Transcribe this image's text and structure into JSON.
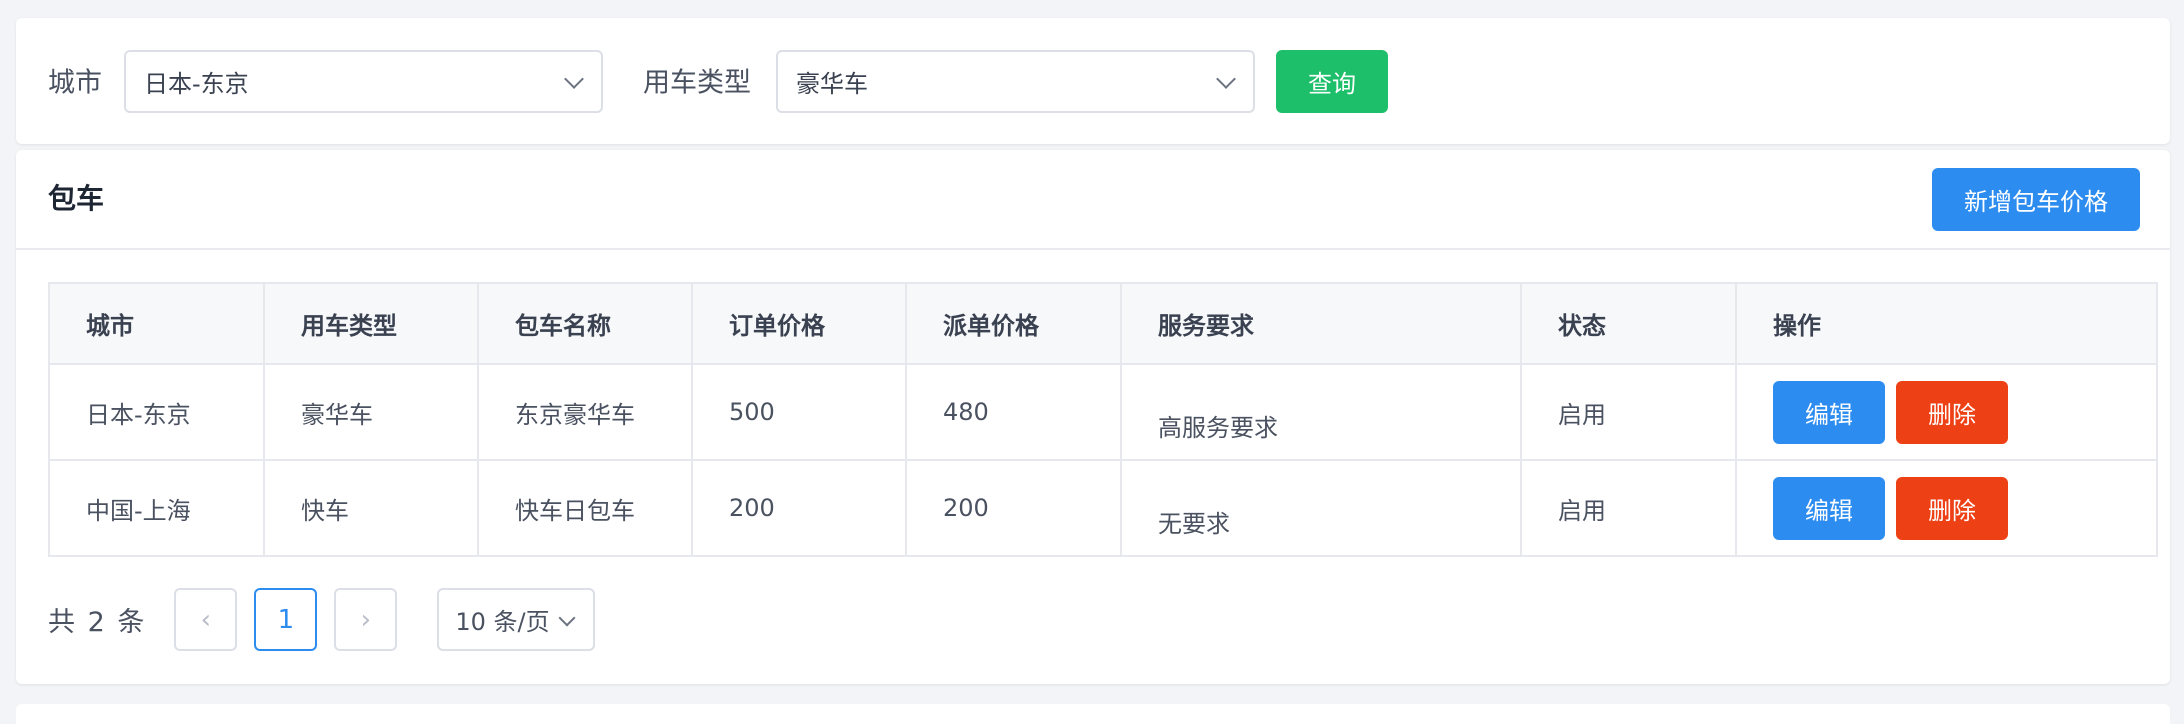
{
  "filter": {
    "city_label": "城市",
    "city_value": "日本-东京",
    "car_type_label": "用车类型",
    "car_type_value": "豪华车",
    "query_button": "查询"
  },
  "section": {
    "title": "包车",
    "add_button": "新增包车价格"
  },
  "table": {
    "columns": [
      "城市",
      "用车类型",
      "包车名称",
      "订单价格",
      "派单价格",
      "服务要求",
      "状态",
      "操作"
    ],
    "rows": [
      {
        "city": "日本-东京",
        "car_type": "豪华车",
        "name": "东京豪华车",
        "order_price": "500",
        "dispatch_price": "480",
        "service": "高服务要求",
        "status": "启用"
      },
      {
        "city": "中国-上海",
        "car_type": "快车",
        "name": "快车日包车",
        "order_price": "200",
        "dispatch_price": "200",
        "service": "无要求",
        "status": "启用"
      }
    ],
    "edit_label": "编辑",
    "delete_label": "删除"
  },
  "pagination": {
    "total_text": "共 2 条",
    "prev": "‹",
    "current_page": "1",
    "next": "›",
    "page_size": "10 条/页"
  },
  "colors": {
    "primary": "#2d8cf0",
    "success": "#1dbf6a",
    "danger": "#ed4014"
  }
}
